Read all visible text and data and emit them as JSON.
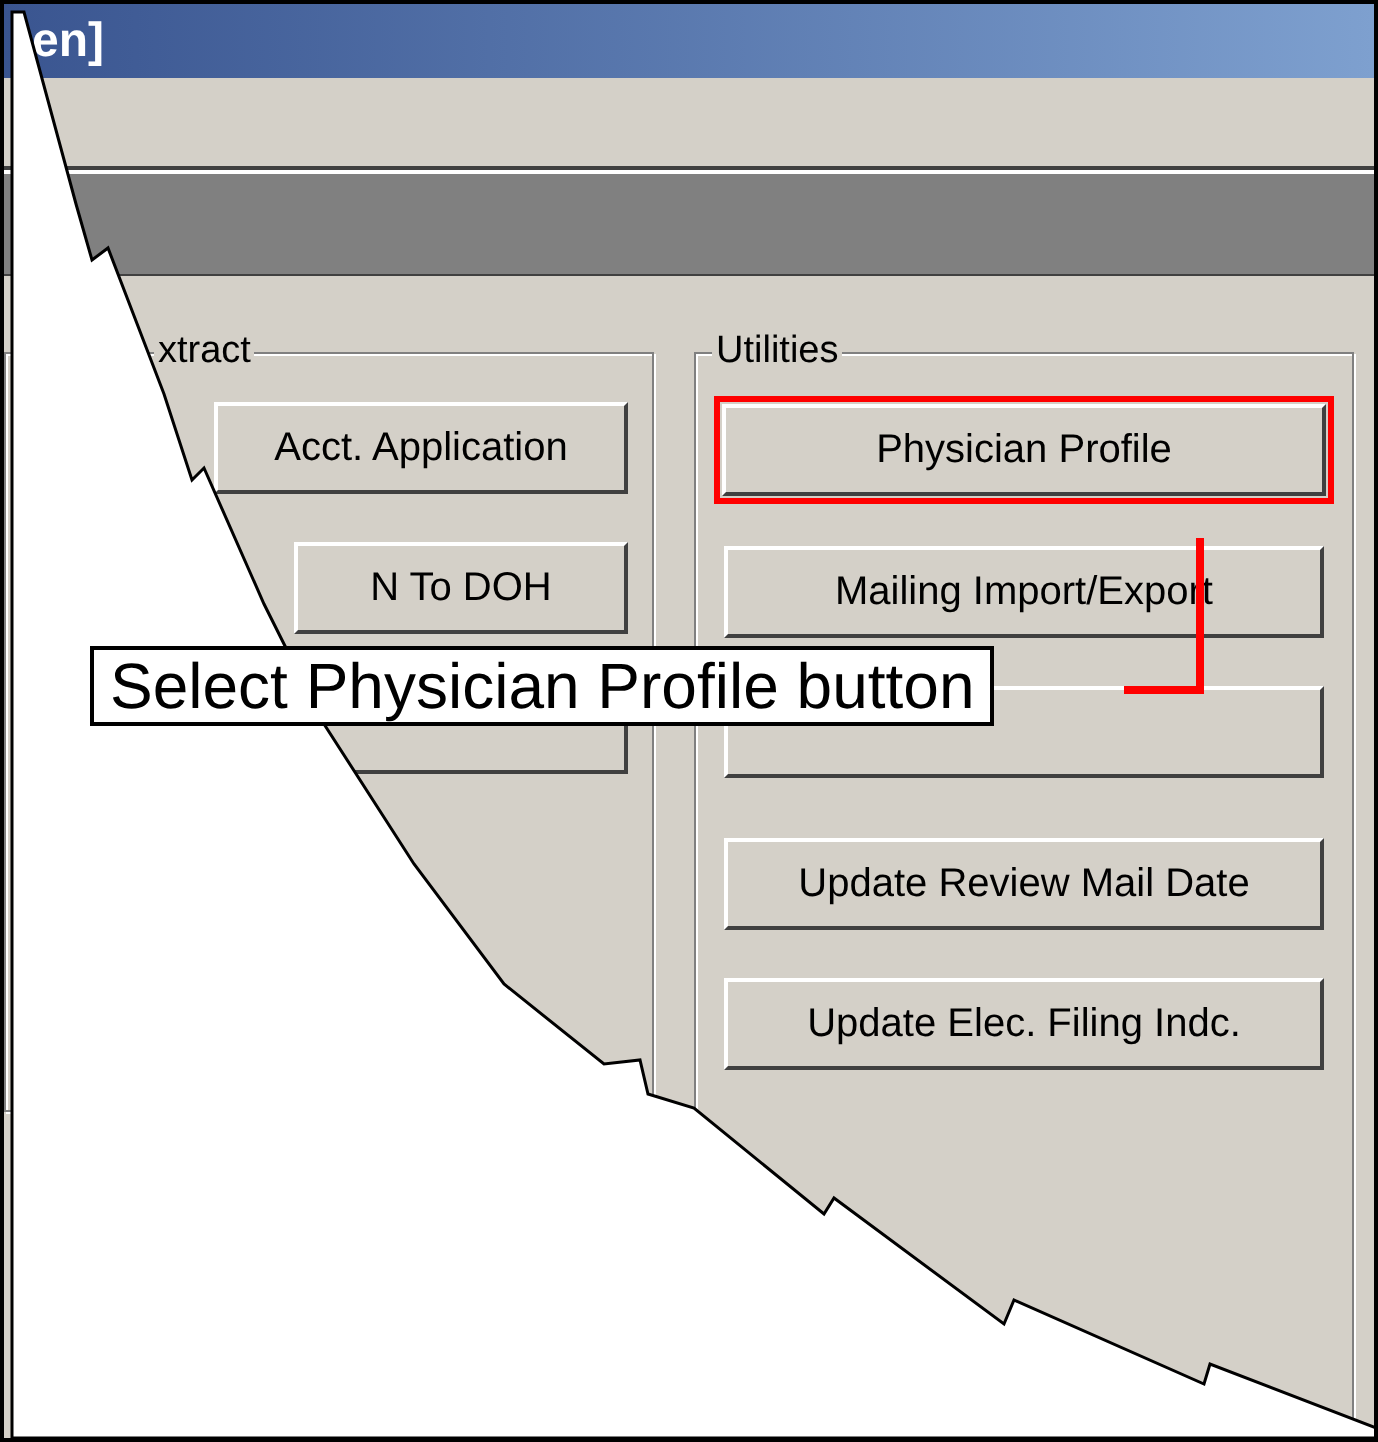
{
  "window": {
    "title": "en]"
  },
  "extract_group": {
    "label": "xtract",
    "buttons": [
      {
        "label": "Acct. Application",
        "covered": false,
        "highlighted": false
      },
      {
        "label": "N To DOH",
        "covered": false,
        "highlighted": false
      },
      {
        "covered": true,
        "highlighted": false
      }
    ]
  },
  "utilities_group": {
    "label": "Utilities",
    "buttons": [
      {
        "label": "Physician Profile",
        "covered": false,
        "highlighted": true
      },
      {
        "label": "Mailing Import/Export",
        "covered": false,
        "highlighted": false
      },
      {
        "covered": true,
        "highlighted": false
      },
      {
        "label": "Update Review Mail Date",
        "covered": false,
        "highlighted": false
      },
      {
        "label": "Update Elec. Filing Indc.",
        "covered": false,
        "highlighted": false
      }
    ]
  },
  "callout": {
    "text": "Select Physician Profile button"
  }
}
